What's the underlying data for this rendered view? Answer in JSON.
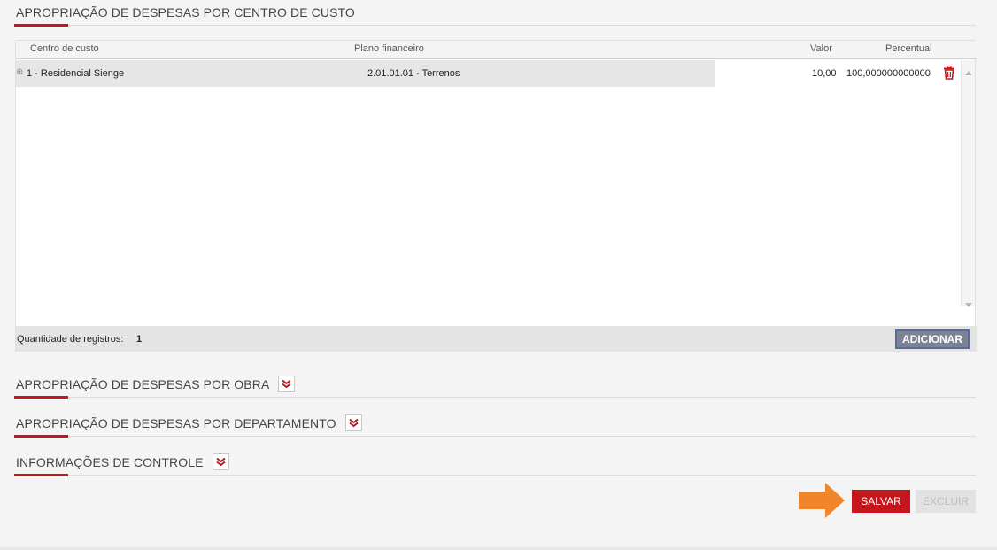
{
  "sections": {
    "centro_custo": {
      "title": "APROPRIAÇÃO DE DESPESAS POR CENTRO DE CUSTO"
    },
    "obra": {
      "title": "APROPRIAÇÃO DE DESPESAS POR OBRA"
    },
    "departamento": {
      "title": "APROPRIAÇÃO DE DESPESAS POR DEPARTAMENTO"
    },
    "controle": {
      "title": "INFORMAÇÕES DE CONTROLE"
    }
  },
  "grid": {
    "columns": {
      "centro": "Centro de custo",
      "plano": "Plano financeiro",
      "valor": "Valor",
      "percentual": "Percentual"
    },
    "rows": [
      {
        "centro": "1 - Residencial Sienge",
        "plano": "2.01.01.01 - Terrenos",
        "valor": "10,00",
        "percentual": "100,000000000000"
      }
    ],
    "footer": {
      "count_label": "Quantidade de registros:",
      "count_value": "1",
      "add_label": "ADICIONAR"
    }
  },
  "actions": {
    "save_label": "SALVAR",
    "delete_label": "EXCLUIR"
  },
  "colors": {
    "accent": "#c4161c",
    "arrow": "#f0852a"
  }
}
